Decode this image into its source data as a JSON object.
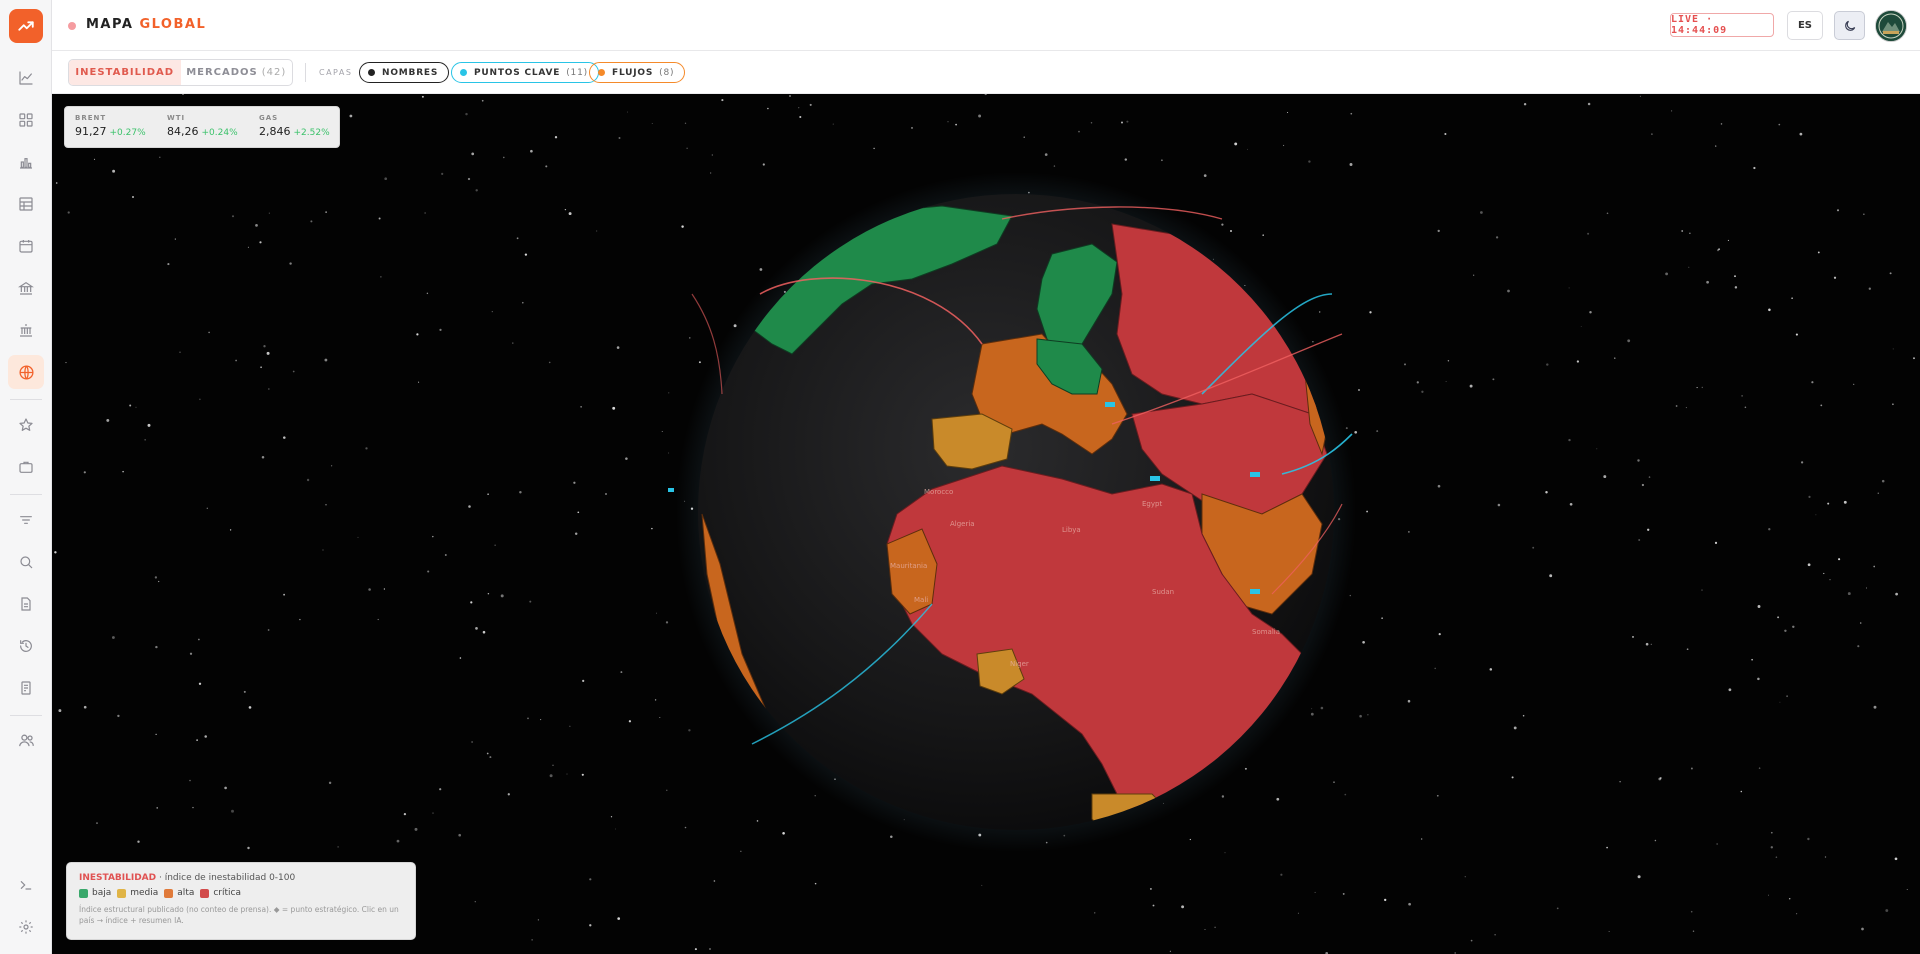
{
  "header": {
    "title_prefix": "MAPA",
    "title_accent": "GLOBAL",
    "live": "LIVE · 14:44:09",
    "lang": "ES"
  },
  "toolbar": {
    "modes": [
      {
        "label": "INESTABILIDAD",
        "count": ""
      },
      {
        "label": "MERCADOS",
        "count": "(42)"
      }
    ],
    "layers_label": "CAPAS",
    "chips": [
      {
        "label": "NOMBRES",
        "count": "",
        "color": "#222222"
      },
      {
        "label": "PUNTOS CLAVE",
        "count": "(11)",
        "color": "#29c4e6"
      },
      {
        "label": "FLUJOS",
        "count": "(8)",
        "color": "#f58a2a"
      }
    ]
  },
  "commodities": [
    {
      "label": "BRENT",
      "value": "91,27",
      "change": "+0.27%"
    },
    {
      "label": "WTI",
      "value": "84,26",
      "change": "+0.24%"
    },
    {
      "label": "GAS",
      "value": "2,846",
      "change": "+2.52%"
    }
  ],
  "legend": {
    "layer_name": "INESTABILIDAD",
    "description": " · índice de inestabilidad 0-100",
    "levels": [
      {
        "label": "baja",
        "color": "#3aa86b"
      },
      {
        "label": "media",
        "color": "#e0b446"
      },
      {
        "label": "alta",
        "color": "#e07a3a"
      },
      {
        "label": "crítica",
        "color": "#d24b4b"
      }
    ],
    "note": "Índice estructural publicado (no conteo de prensa). ◆ = punto estratégico. Clic en un país → índice + resumen IA."
  },
  "map_labels": [
    "Algeria",
    "Libya",
    "Mali",
    "Niger",
    "Egypt",
    "Sudan",
    "Somalia",
    "Mauritania",
    "Morocco"
  ],
  "colors": {
    "accent": "#f2612a",
    "critical": "#c0383c",
    "high": "#c8661e",
    "low": "#1f8a4a",
    "medium": "#c98a2a"
  },
  "icons": [
    "trend-up-icon",
    "line-chart-icon",
    "grid-icon",
    "bar-chart-icon",
    "table-icon",
    "calendar-icon",
    "bank-icon",
    "institution-icon",
    "globe-icon",
    "star-icon",
    "briefcase-icon",
    "filter-icon",
    "search-icon",
    "document-icon",
    "history-icon",
    "receipt-icon",
    "users-icon",
    "terminal-icon",
    "gear-icon",
    "moon-icon"
  ]
}
